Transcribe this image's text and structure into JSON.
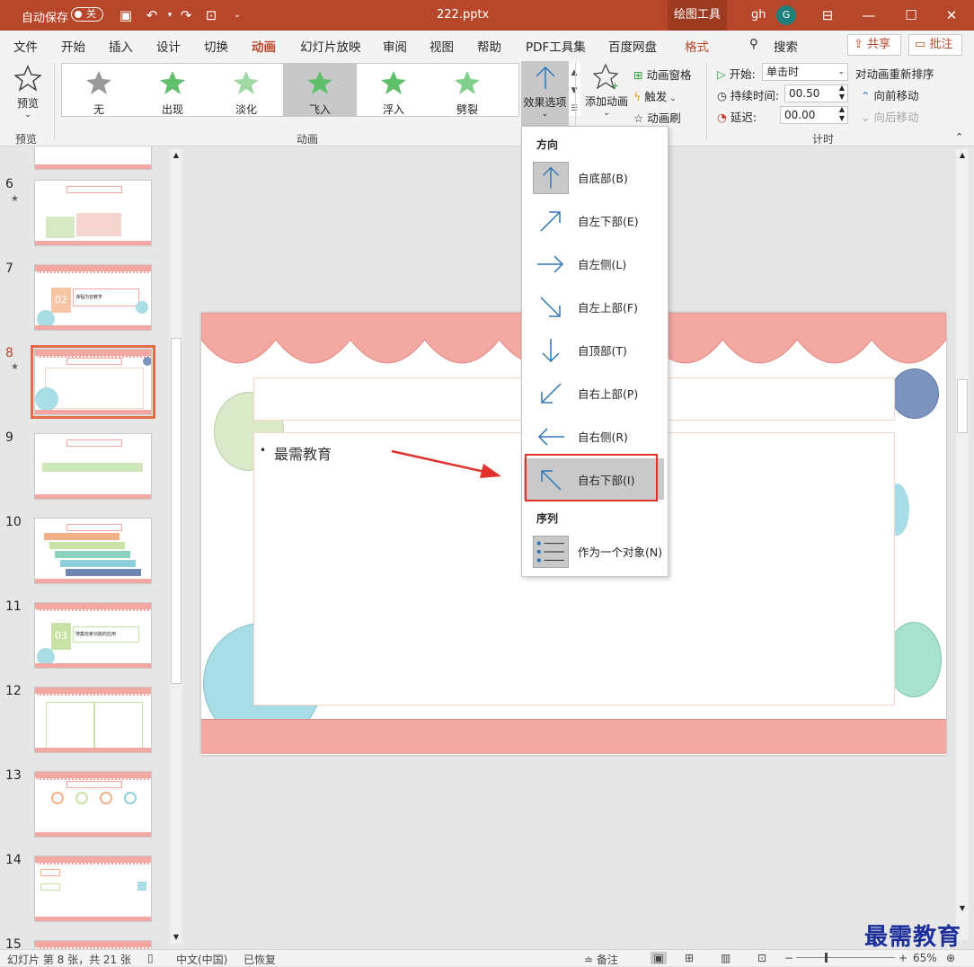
{
  "titlebar": {
    "autosave_label": "自动保存",
    "autosave_state": "关",
    "filename": "222.pptx",
    "context_tool": "绘图工具",
    "user_name": "gh",
    "user_initial": "G"
  },
  "tabs": [
    "文件",
    "开始",
    "插入",
    "设计",
    "切换",
    "动画",
    "幻灯片放映",
    "审阅",
    "视图",
    "帮助",
    "PDF工具集",
    "百度网盘",
    "格式"
  ],
  "active_tab": "动画",
  "search_label": "搜索",
  "share_label": "共享",
  "comment_label": "批注",
  "ribbon": {
    "preview_label": "预览",
    "preview_group": "预览",
    "animations": [
      "无",
      "出现",
      "淡化",
      "飞入",
      "浮入",
      "劈裂"
    ],
    "selected_animation": "飞入",
    "animation_group": "动画",
    "effect_options_label": "效果选项",
    "add_animation_label": "添加动画",
    "animation_pane_label": "动画窗格",
    "trigger_label": "触发",
    "animation_painter_label": "动画刷",
    "start_label": "开始:",
    "start_value": "单击时",
    "duration_label": "持续时间:",
    "duration_value": "00.50",
    "delay_label": "延迟:",
    "delay_value": "00.00",
    "reorder_label": "对动画重新排序",
    "move_earlier_label": "向前移动",
    "move_later_label": "向后移动",
    "timing_group": "计时"
  },
  "dropdown": {
    "direction_header": "方向",
    "directions": [
      {
        "label": "自底部(B)",
        "icon": "arrow-up-icon"
      },
      {
        "label": "自左下部(E)",
        "icon": "arrow-up-right-icon"
      },
      {
        "label": "自左侧(L)",
        "icon": "arrow-right-icon"
      },
      {
        "label": "自左上部(F)",
        "icon": "arrow-down-right-icon"
      },
      {
        "label": "自顶部(T)",
        "icon": "arrow-down-icon"
      },
      {
        "label": "自右上部(P)",
        "icon": "arrow-down-left-icon"
      },
      {
        "label": "自右侧(R)",
        "icon": "arrow-left-icon"
      },
      {
        "label": "自右下部(I)",
        "icon": "arrow-up-left-icon"
      }
    ],
    "sequence_header": "序列",
    "sequence_item": "作为一个对象(N)"
  },
  "slides": [
    {
      "num": "6",
      "star": true
    },
    {
      "num": "7",
      "star": false,
      "text": "课程内容教学"
    },
    {
      "num": "8",
      "star": true,
      "current": true
    },
    {
      "num": "9",
      "star": false
    },
    {
      "num": "10",
      "star": false
    },
    {
      "num": "11",
      "star": false,
      "text": "搜集检索功能的应用"
    },
    {
      "num": "12",
      "star": false
    },
    {
      "num": "13",
      "star": false
    },
    {
      "num": "14",
      "star": false
    },
    {
      "num": "15",
      "star": false
    }
  ],
  "slide_content": {
    "bullet_text": "最需教育"
  },
  "status": {
    "slide_info": "幻灯片 第 8 张，共 21 张",
    "language": "中文(中国)",
    "recovered": "已恢复",
    "notes_label": "备注",
    "zoom": "65%"
  },
  "watermark": "最需教育",
  "colors": {
    "accent": "#b7472a",
    "highlight_box": "#e0322b",
    "scallop": "#f4a8a2",
    "arrow_blue": "#2e75b6"
  }
}
